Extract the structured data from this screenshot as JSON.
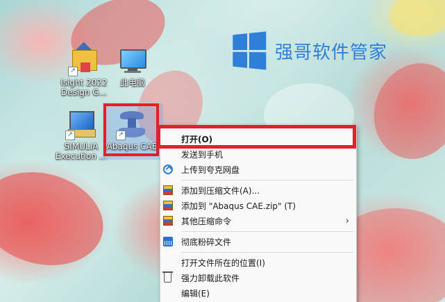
{
  "watermark": {
    "text": "强哥软件管家",
    "logo_icon": "windows-logo-icon",
    "color": "#2f7fd8"
  },
  "desktop_icons": {
    "isight": {
      "label_line1": "Isight 2022",
      "label_line2": "Design G...",
      "icon": "isight-app-icon"
    },
    "pc": {
      "label": "此电脑",
      "icon": "computer-icon"
    },
    "simulia": {
      "label_line1": "SIMULIA",
      "label_line2": "Execution ...",
      "icon": "simulia-app-icon"
    },
    "abaqus": {
      "label": "Abaqus CAE",
      "icon": "abaqus-app-icon",
      "selected": true
    }
  },
  "context_menu": {
    "items": [
      {
        "label": "打开(O)",
        "icon": ""
      },
      {
        "label": "发送到手机",
        "icon": ""
      },
      {
        "label": "上传到夸克网盘",
        "icon": "cloud-upload-icon"
      },
      {
        "label": "添加到压缩文件(A)...",
        "icon": "winrar-icon"
      },
      {
        "label": "添加到 \"Abaqus CAE.zip\" (T)",
        "icon": "winrar-icon"
      },
      {
        "label": "其他压缩命令",
        "icon": "winrar-icon",
        "submenu": true
      },
      {
        "label": "彻底粉碎文件",
        "icon": "shredder-icon"
      },
      {
        "label": "打开文件所在的位置(I)",
        "icon": ""
      },
      {
        "label": "强力卸载此软件",
        "icon": "trash-icon"
      },
      {
        "label": "编辑(E)",
        "icon": ""
      }
    ],
    "submenu_arrow": "›"
  },
  "highlight_color": "#e0202a"
}
